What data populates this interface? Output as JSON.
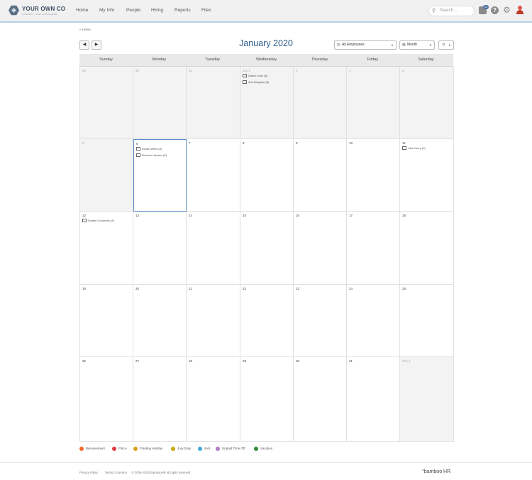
{
  "company": {
    "name": "YOUR OWN CO",
    "tagline": "COMPANY LOGO GOES HERE"
  },
  "nav": [
    "Home",
    "My Info",
    "People",
    "Hiring",
    "Reports",
    "Files"
  ],
  "search": {
    "placeholder": "Search..."
  },
  "inbox": {
    "count": "12"
  },
  "breadcrumb": "« Home",
  "calendar": {
    "title": "January 2020",
    "filter": "All Employees",
    "view": "Month",
    "weekdays": [
      "Sunday",
      "Monday",
      "Tuesday",
      "Wednesday",
      "Thursday",
      "Friday",
      "Saturday"
    ],
    "weeks": [
      [
        {
          "day": "29",
          "dim": true
        },
        {
          "day": "30",
          "dim": true
        },
        {
          "day": "31",
          "dim": true
        },
        {
          "day": "Jan 1",
          "dim": true,
          "events": [
            "Daniel John (8)",
            "Ana Delgado (8)"
          ]
        },
        {
          "day": "2",
          "dim": true
        },
        {
          "day": "3",
          "dim": true
        },
        {
          "day": "4",
          "dim": true
        }
      ],
      [
        {
          "day": "5",
          "dim": true
        },
        {
          "day": "6",
          "selected": true,
          "events": [
            "Dustin Wells (8)",
            "Brenton Hansen (8)"
          ]
        },
        {
          "day": "7"
        },
        {
          "day": "8"
        },
        {
          "day": "9"
        },
        {
          "day": "10"
        },
        {
          "day": "11",
          "events": [
            "Jack Kerry (2)"
          ]
        }
      ],
      [
        {
          "day": "12",
          "events": [
            "Dwight Goodman (8)"
          ]
        },
        {
          "day": "13"
        },
        {
          "day": "14"
        },
        {
          "day": "15"
        },
        {
          "day": "16"
        },
        {
          "day": "17"
        },
        {
          "day": "18"
        }
      ],
      [
        {
          "day": "19"
        },
        {
          "day": "20"
        },
        {
          "day": "21"
        },
        {
          "day": "22"
        },
        {
          "day": "23"
        },
        {
          "day": "24"
        },
        {
          "day": "25"
        }
      ],
      [
        {
          "day": "26"
        },
        {
          "day": "27"
        },
        {
          "day": "28"
        },
        {
          "day": "29"
        },
        {
          "day": "30"
        },
        {
          "day": "31"
        },
        {
          "day": "Feb 1",
          "dim": true
        }
      ]
    ]
  },
  "legend": [
    {
      "label": "Bereavement",
      "color": "#f26a2e"
    },
    {
      "label": "FMLA",
      "color": "#e23b3b"
    },
    {
      "label": "Floating Holiday",
      "color": "#d9a21b"
    },
    {
      "label": "Jury Duty",
      "color": "#c9a70a"
    },
    {
      "label": "Sick",
      "color": "#3fa9d6"
    },
    {
      "label": "Unpaid Time Off",
      "color": "#b07cc6"
    },
    {
      "label": "Vacation",
      "color": "#2e8b3a"
    }
  ],
  "footer": {
    "privacy": "Privacy Policy",
    "sep": "·",
    "terms": "Terms of Service",
    "copyright": "· © 2008–2020 BambooHR All rights reserved.",
    "brand": "°bamboo HR"
  }
}
